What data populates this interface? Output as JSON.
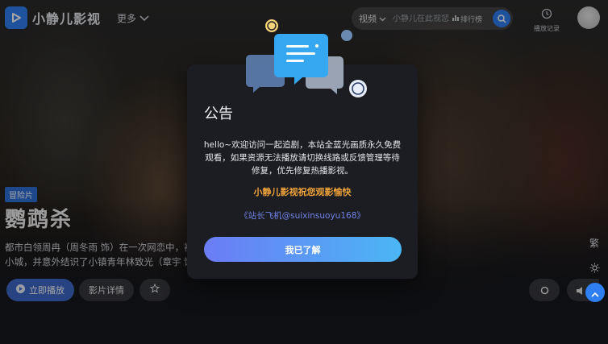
{
  "app": {
    "name": "小静儿影视",
    "more_label": "更多"
  },
  "search": {
    "type_label": "视频",
    "placeholder": "小静儿在此视您",
    "rank_label": "排行榜"
  },
  "header": {
    "history_label": "播放记录"
  },
  "hero": {
    "genre": "冒险片",
    "title": "鹦鹉杀",
    "description_line1": "都市白领周冉（周冬雨 饰）在一次网恋中，被",
    "description_line2": "小城，并意外结识了小镇青年林致光（章宇 饰",
    "play_label": "立即播放",
    "detail_label": "影片详情"
  },
  "side_tools": {
    "traditional_label": "繁"
  },
  "modal": {
    "title": "公告",
    "body": "hello~欢迎访问一起追剧，本站全蓝光画质永久免费观看，如果资源无法播放请切换线路或反馈管理等待修复，优先修复热播影视。",
    "highlight": "小静儿影视祝您观影愉快",
    "contact": "《站长飞机@suixinsuoyu168》",
    "confirm_label": "我已了解"
  },
  "colors": {
    "accent": "#2e7ff2",
    "highlight": "#f0a33a",
    "contact": "#6f83e8",
    "button_gradient_start": "#6b7cf5",
    "button_gradient_end": "#4bb6f5",
    "modal_bg": "#1c1d22"
  },
  "icons": {
    "logo": "play-logo-icon",
    "more": "chevron-down-icon",
    "search_type": "chevron-down-icon",
    "rank": "bar-chart-icon",
    "search": "search-icon",
    "history": "clock-icon",
    "play": "play-icon",
    "favorite": "star-icon",
    "theme": "sun-icon",
    "scroll_top": "chevron-up-icon"
  }
}
